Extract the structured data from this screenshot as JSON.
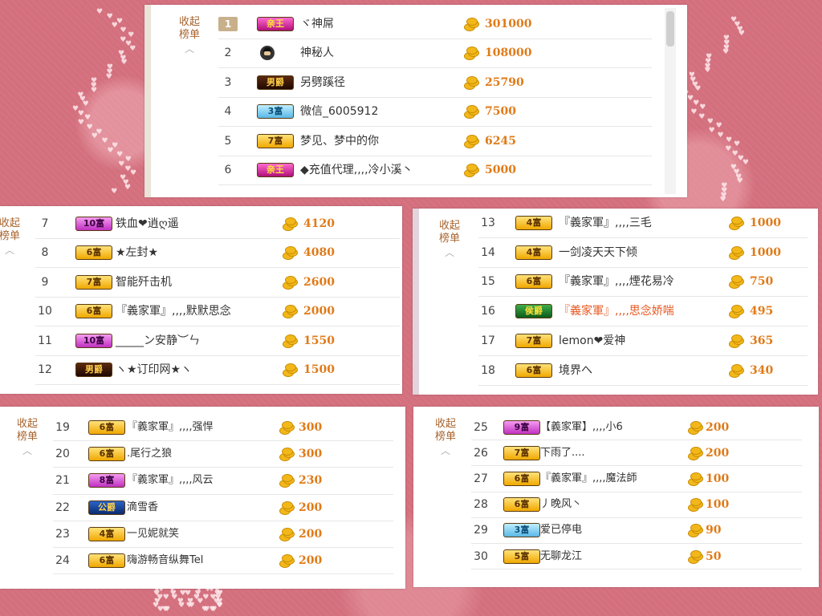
{
  "collapse_label": [
    "收起",
    "榜单"
  ],
  "panels": [
    {
      "rows": [
        {
          "rank": "1",
          "badge": "亲王",
          "badge_class": "b-king",
          "name": "ヾ神屌",
          "amount": "301000",
          "top": true
        },
        {
          "rank": "2",
          "badge": "",
          "badge_class": "mystery",
          "name": "神秘人",
          "amount": "108000"
        },
        {
          "rank": "3",
          "badge": "男爵",
          "badge_class": "b-nan",
          "name": "另劈蹊径",
          "amount": "25790"
        },
        {
          "rank": "4",
          "badge": "3富",
          "badge_class": "b-rich3",
          "name": "微信_6005912",
          "amount": "7500"
        },
        {
          "rank": "5",
          "badge": "7富",
          "badge_class": "b-rich7",
          "name": "梦见、梦中的你",
          "amount": "6245"
        },
        {
          "rank": "6",
          "badge": "亲王",
          "badge_class": "b-king",
          "name": "◆充值代理,,,,冷小溪丶",
          "amount": "5000"
        }
      ]
    },
    {
      "rows": [
        {
          "rank": "7",
          "badge": "10富",
          "badge_class": "b-rich10",
          "name": "铁血❤逍ღ遥",
          "amount": "4120"
        },
        {
          "rank": "8",
          "badge": "6富",
          "badge_class": "b-rich6",
          "name": "★左封★",
          "amount": "4080"
        },
        {
          "rank": "9",
          "badge": "7富",
          "badge_class": "b-rich7",
          "name": "智能歼击机",
          "amount": "2600"
        },
        {
          "rank": "10",
          "badge": "6富",
          "badge_class": "b-rich6",
          "name": "『義家軍』,,,,默默思念",
          "amount": "2000"
        },
        {
          "rank": "11",
          "badge": "10富",
          "badge_class": "b-rich10",
          "name": "_____ン安静︶ㄣ",
          "amount": "1550"
        },
        {
          "rank": "12",
          "badge": "男爵",
          "badge_class": "b-nan",
          "name": "ヽ★订印网★ヽ",
          "amount": "1500"
        }
      ]
    },
    {
      "rows": [
        {
          "rank": "13",
          "badge": "4富",
          "badge_class": "b-rich4",
          "name": "『義家軍』,,,,三毛",
          "amount": "1000"
        },
        {
          "rank": "14",
          "badge": "4富",
          "badge_class": "b-rich4",
          "name": "一剑凌天天下倾",
          "amount": "1000"
        },
        {
          "rank": "15",
          "badge": "6富",
          "badge_class": "b-rich6",
          "name": "『義家軍』,,,,煙花易冷",
          "amount": "750"
        },
        {
          "rank": "16",
          "badge": "侯爵",
          "badge_class": "b-hou",
          "name": "『義家軍』,,,,思念娇喘",
          "amount": "495",
          "hl": true
        },
        {
          "rank": "17",
          "badge": "7富",
          "badge_class": "b-rich7",
          "name": "lemon❤爱神",
          "amount": "365"
        },
        {
          "rank": "18",
          "badge": "6富",
          "badge_class": "b-rich6",
          "name": "境界へ",
          "amount": "340"
        }
      ]
    },
    {
      "rows": [
        {
          "rank": "19",
          "badge": "6富",
          "badge_class": "b-rich6",
          "name": "『義家軍』,,,,强悍",
          "amount": "300"
        },
        {
          "rank": "20",
          "badge": "6富",
          "badge_class": "b-rich6",
          "name": ".尾行之狼",
          "amount": "300"
        },
        {
          "rank": "21",
          "badge": "8富",
          "badge_class": "b-rich8",
          "name": "『義家軍』,,,,风云",
          "amount": "230"
        },
        {
          "rank": "22",
          "badge": "公爵",
          "badge_class": "b-duke",
          "name": "滴雪香",
          "amount": "200"
        },
        {
          "rank": "23",
          "badge": "4富",
          "badge_class": "b-rich4",
          "name": "一见妮就笑",
          "amount": "200"
        },
        {
          "rank": "24",
          "badge": "6富",
          "badge_class": "b-rich6",
          "name": "嗨游畅音纵舞Tel",
          "amount": "200"
        }
      ]
    },
    {
      "rows": [
        {
          "rank": "25",
          "badge": "9富",
          "badge_class": "b-rich9",
          "name": "【義家軍】,,,,小6",
          "amount": "200"
        },
        {
          "rank": "26",
          "badge": "7富",
          "badge_class": "b-rich7",
          "name": "下雨了....",
          "amount": "200"
        },
        {
          "rank": "27",
          "badge": "6富",
          "badge_class": "b-rich6",
          "name": "『義家軍』,,,,魔法師",
          "amount": "100"
        },
        {
          "rank": "28",
          "badge": "6富",
          "badge_class": "b-rich6",
          "name": "丿晚风丶",
          "amount": "100"
        },
        {
          "rank": "29",
          "badge": "3富",
          "badge_class": "b-rich3",
          "name": "爱已停电",
          "amount": "90"
        },
        {
          "rank": "30",
          "badge": "5富",
          "badge_class": "b-rich5",
          "name": "无聊龙江",
          "amount": "50"
        }
      ]
    }
  ]
}
